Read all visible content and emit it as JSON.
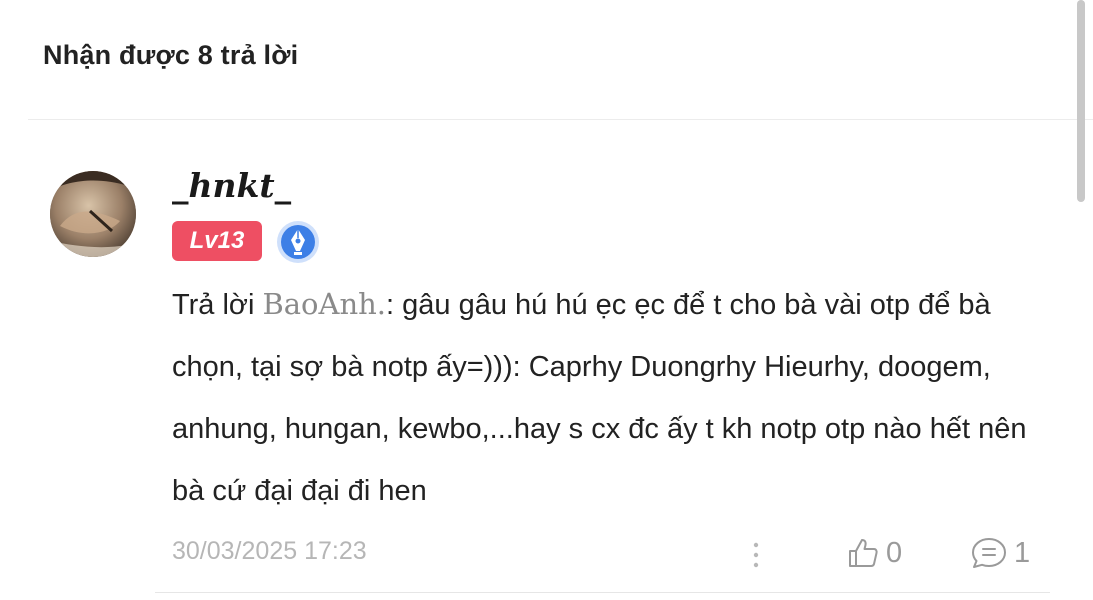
{
  "header": {
    "title": "Nhận được 8 trả lời"
  },
  "reply": {
    "username": "_hnkt_",
    "level": "Lv13",
    "text_prefix": "Trả lời ",
    "quoted_user": "BaoAnh.",
    "text_body": ": gâu gâu hú hú ẹc ẹc để t cho bà vài otp để bà chọn, tại sợ bà notp ấy=))): Caprhy Duongrhy Hieurhy, doogem, anhung, hungan, kewbo,...hay s cx đc ấy t kh notp otp nào hết nên bà cứ đại đại đi hen",
    "timestamp": "30/03/2025 17:23",
    "like_count": "0",
    "comment_count": "1"
  },
  "icons": {
    "pen_badge": "pen-badge-icon",
    "more": "more-vertical-icon",
    "like": "thumbs-up-icon",
    "comment": "comment-icon"
  },
  "colors": {
    "level_badge": "#ee4f63",
    "pen_badge": "#3d7fe6",
    "muted": "#9a9a9a"
  }
}
